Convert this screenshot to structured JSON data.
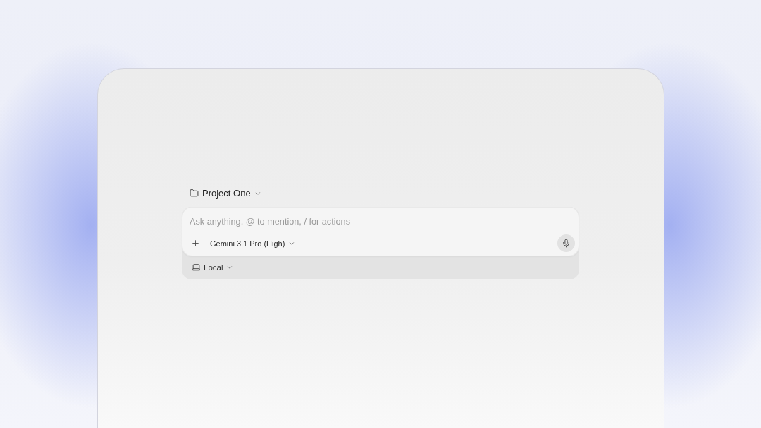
{
  "project_selector": {
    "label": "Project One"
  },
  "composer": {
    "placeholder": "Ask anything, @ to mention, / for actions",
    "model_selector": {
      "label": "Gemini 3.1 Pro (High)"
    }
  },
  "environment_selector": {
    "label": "Local"
  }
}
